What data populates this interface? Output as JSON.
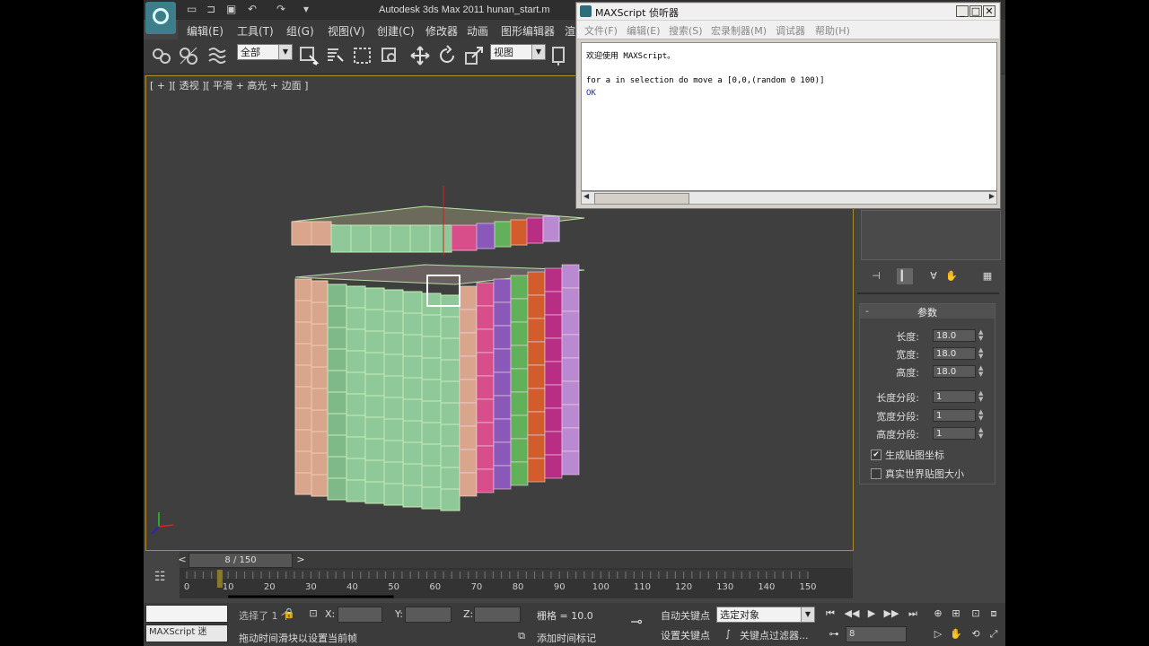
{
  "title": "Autodesk 3ds Max  2011      hunan_start.m",
  "menu": [
    "编辑(E)",
    "工具(T)",
    "组(G)",
    "视图(V)",
    "创建(C)",
    "修改器",
    "动画",
    "图形编辑器",
    "渲"
  ],
  "toolbar": {
    "filter_combo": "全部",
    "coord_combo": "视图"
  },
  "viewport": {
    "label": "[ + ][ 透视 ][ 平滑 + 高光 + 边面 ]"
  },
  "maxscript": {
    "title": "MAXScript 侦听器",
    "menu": [
      "文件(F)",
      "编辑(E)",
      "搜索(S)",
      "宏录制器(M)",
      "调试器",
      "帮助(H)"
    ],
    "lines": [
      "欢迎使用 MAXScript。",
      "",
      "for a in selection do move a [0,0,(random 0 100)]",
      "OK"
    ]
  },
  "params": {
    "header": "参数",
    "fields": [
      {
        "label": "长度:",
        "value": "18.0"
      },
      {
        "label": "宽度:",
        "value": "18.0"
      },
      {
        "label": "高度:",
        "value": "18.0"
      },
      {
        "label": "长度分段:",
        "value": "1"
      },
      {
        "label": "宽度分段:",
        "value": "1"
      },
      {
        "label": "高度分段:",
        "value": "1"
      }
    ],
    "checkboxes": [
      {
        "label": "生成贴图坐标",
        "checked": true
      },
      {
        "label": "真实世界贴图大小",
        "checked": false
      }
    ]
  },
  "timeline": {
    "frame_label": "8 / 150",
    "current_frame": 8,
    "total_frames": 150,
    "ruler_ticks": [
      "0",
      "10",
      "20",
      "30",
      "40",
      "50",
      "60",
      "70",
      "80",
      "90",
      "100",
      "110",
      "120",
      "130",
      "140",
      "150"
    ]
  },
  "status": {
    "selection_text": "选择了 1 个",
    "x_label": "X:",
    "y_label": "Y:",
    "z_label": "Z:",
    "grid_text": "栅格 = 10.0",
    "prompt_text": "拖动时间滑块以设置当前帧",
    "add_time_tag": "添加时间标记",
    "auto_key": "自动关键点",
    "set_key": "设置关键点",
    "selected_combo": "选定对象",
    "key_filter": "关键点过滤器...",
    "frame_field": "8",
    "maxscript_mini": "MAXScript 迷"
  },
  "colors": {
    "stripes": [
      "#d9a58c",
      "#8fc99a",
      "#d84e8a",
      "#8a58b8",
      "#62b05a",
      "#d35c2c",
      "#b82e84",
      "#b98ad2"
    ]
  }
}
